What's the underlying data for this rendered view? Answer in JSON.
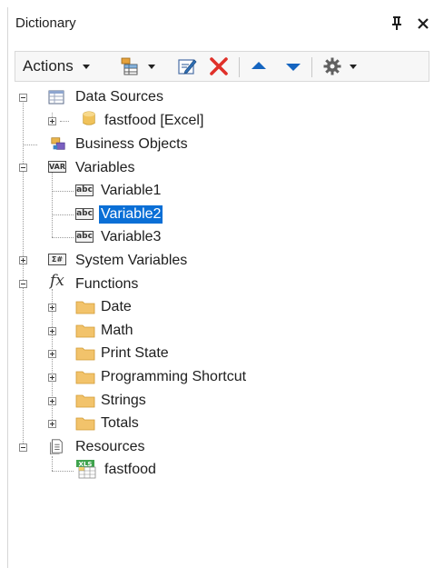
{
  "panel": {
    "title": "Dictionary",
    "pin_glyph": "Ѩ",
    "close_glyph": "×"
  },
  "toolbar": {
    "actions_label": "Actions",
    "icons": [
      "new-item-icon",
      "edit-icon",
      "delete-icon",
      "move-up-icon",
      "move-down-icon",
      "settings-icon"
    ],
    "colors": {
      "delete": "#e0312a",
      "arrows": "#1565c0",
      "settings": "#606060"
    }
  },
  "tree": {
    "data_sources": {
      "label": "Data Sources",
      "children": [
        {
          "label": "fastfood [Excel]"
        }
      ]
    },
    "business_objects": {
      "label": "Business Objects"
    },
    "variables": {
      "label": "Variables",
      "icon_text": "VAR",
      "children": [
        {
          "label": "Variable1",
          "icon_text": "abc"
        },
        {
          "label": "Variable2",
          "icon_text": "abc",
          "selected": true
        },
        {
          "label": "Variable3",
          "icon_text": "abc"
        }
      ]
    },
    "system_variables": {
      "label": "System Variables",
      "icon_text": "Σ#"
    },
    "functions": {
      "label": "Functions",
      "icon_text": "fx",
      "children": [
        {
          "label": "Date"
        },
        {
          "label": "Math"
        },
        {
          "label": "Print State"
        },
        {
          "label": "Programming Shortcut"
        },
        {
          "label": "Strings"
        },
        {
          "label": "Totals"
        }
      ]
    },
    "resources": {
      "label": "Resources",
      "children": [
        {
          "label": "fastfood",
          "icon_text": "XLS"
        }
      ]
    },
    "selection_color": "#0a6fd6"
  }
}
